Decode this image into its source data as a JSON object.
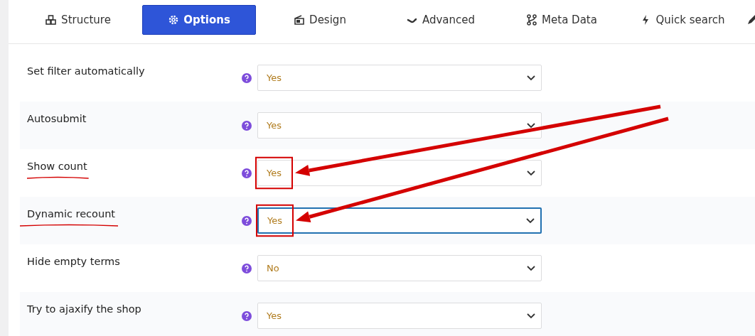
{
  "tabs": [
    {
      "label": "Structure",
      "kind": "cubes",
      "selected": false
    },
    {
      "label": "Options",
      "kind": "gear",
      "selected": true
    },
    {
      "label": "Design",
      "kind": "palette",
      "selected": false
    },
    {
      "label": "Advanced",
      "kind": "wave",
      "selected": false
    },
    {
      "label": "Meta Data",
      "kind": "nodes",
      "selected": false
    },
    {
      "label": "Quick search",
      "kind": "bolt",
      "selected": false
    },
    {
      "kind": "pen",
      "selected": false
    }
  ],
  "options": [
    {
      "label": "Set filter automatically",
      "value": "Yes",
      "focused": false,
      "highlighted": false
    },
    {
      "label": "Autosubmit",
      "value": "Yes",
      "focused": false,
      "highlighted": false
    },
    {
      "label": "Show count",
      "value": "Yes",
      "focused": false,
      "highlighted": true
    },
    {
      "label": "Dynamic recount",
      "value": "Yes",
      "focused": true,
      "highlighted": true
    },
    {
      "label": "Hide empty terms",
      "value": "No",
      "focused": false,
      "highlighted": false
    },
    {
      "label": "Try to ajaxify the shop",
      "value": "Yes",
      "focused": false,
      "highlighted": false
    }
  ]
}
